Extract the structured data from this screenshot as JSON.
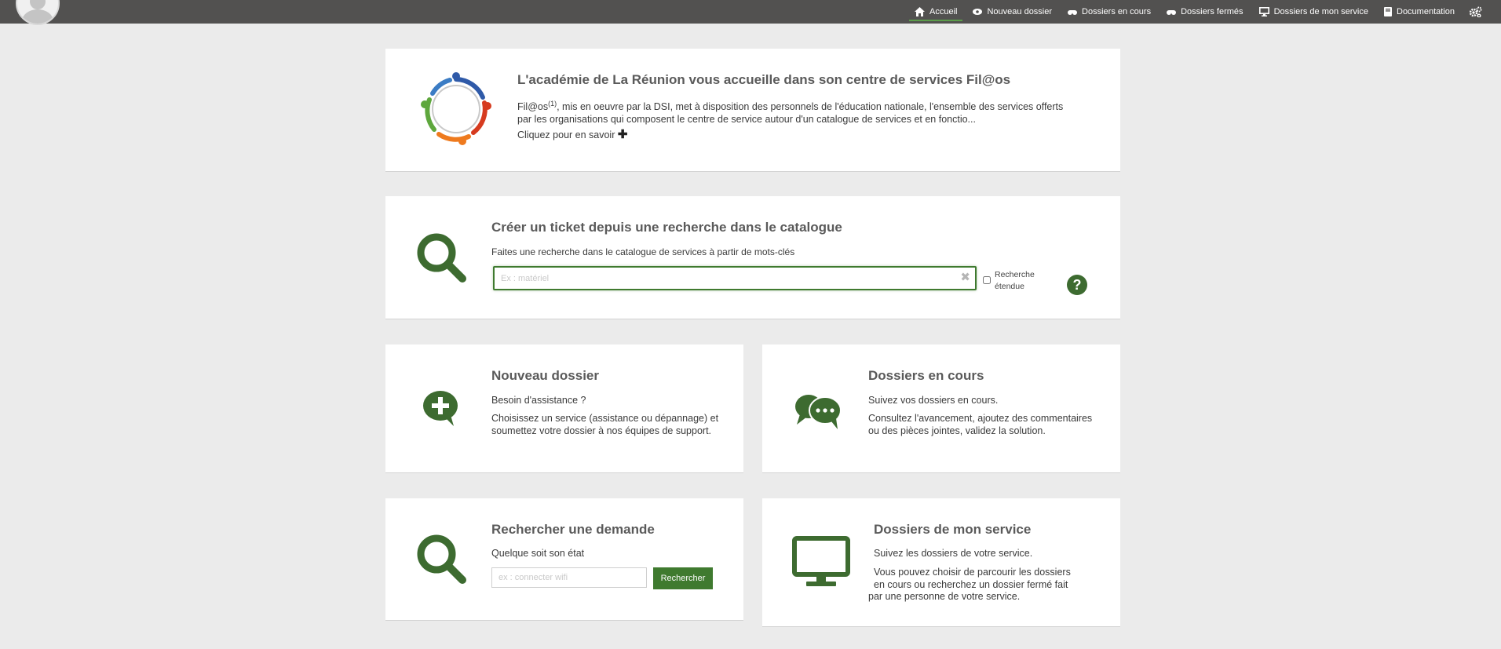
{
  "colors": {
    "topbar": "#525150",
    "accent": "#3d6b30",
    "background": "#ebebeb"
  },
  "nav": {
    "items": [
      {
        "label": "Accueil",
        "icon": "home-icon",
        "active": true
      },
      {
        "label": "Nouveau dossier",
        "icon": "eye-icon"
      },
      {
        "label": "Dossiers en cours",
        "icon": "binoculars-icon"
      },
      {
        "label": "Dossiers fermés",
        "icon": "binoculars-icon"
      },
      {
        "label": "Dossiers de mon service",
        "icon": "desktop-icon"
      },
      {
        "label": "Documentation",
        "icon": "book-icon"
      }
    ],
    "settings_icon": "gears-icon"
  },
  "welcome": {
    "title": "L'académie de La Réunion vous accueille dans son centre de services Fil@os",
    "text_prefix": "Fil@os",
    "text_sup": "(1)",
    "text_line1": ", mis en oeuvre par la DSI, met à disposition des personnels de l'éducation nationale, l'ensemble des services offerts",
    "text_line2": "par les organisations qui composent le centre de service autour d'un catalogue de services et en fonctio...",
    "more_link": "Cliquez pour en savoir",
    "more_icon": "plus-icon"
  },
  "catalog_search": {
    "title": "Créer un ticket depuis une recherche dans le catalogue",
    "subtitle": "Faites une recherche dans le catalogue de services à partir de mots-clés",
    "placeholder": "Ex : matériel",
    "clear_icon": "times-icon",
    "extended_label_line1": "Recherche",
    "extended_label_line2": "étendue",
    "help_icon": "question-circle-icon"
  },
  "new_ticket": {
    "title": "Nouveau dossier",
    "line1": "Besoin d'assistance ?",
    "line2": "Choisissez un service (assistance ou dépannage) et soumettez votre dossier à nos équipes de support."
  },
  "ongoing": {
    "title": "Dossiers en cours",
    "line1": "Suivez vos dossiers en cours.",
    "line2": "Consultez l'avancement, ajoutez des commentaires ou des pièces jointes, validez la solution."
  },
  "search_request": {
    "title": "Rechercher une demande",
    "line1": "Quelque soit son état",
    "placeholder": "ex : connecter wifi",
    "button": "Rechercher"
  },
  "my_service": {
    "title": "Dossiers de mon service",
    "line1": "Suivez les dossiers de votre service.",
    "line2a": "Vous pouvez choisir de parcourir les dossiers",
    "line2b": "en cours ou recherchez un dossier fermé fait",
    "line2c": "par une personne de votre service."
  }
}
